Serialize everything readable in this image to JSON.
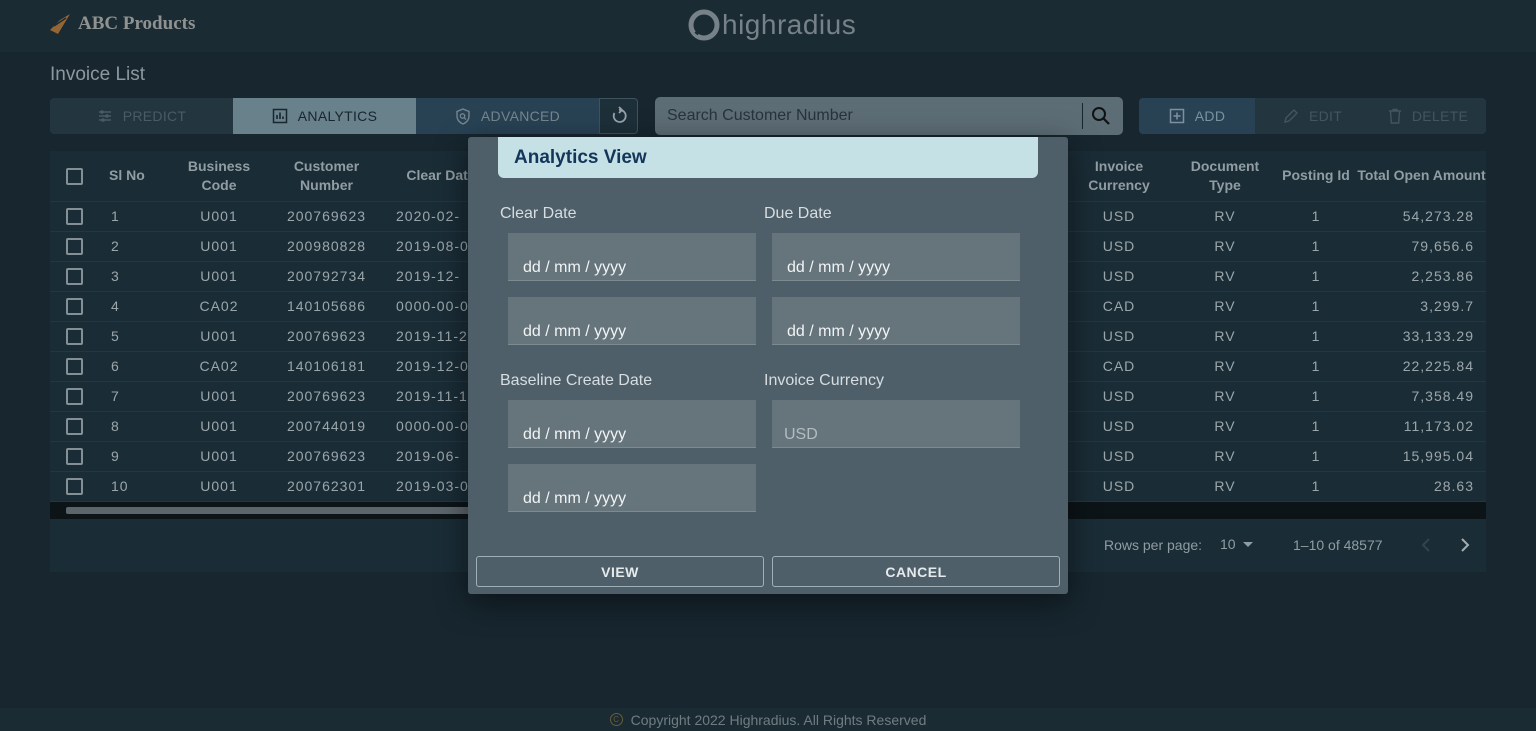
{
  "header": {
    "brand": "ABC Products",
    "center_logo": "highradius"
  },
  "page_title": "Invoice List",
  "toolbar": {
    "predict": "PREDICT",
    "analytics": "ANALYTICS",
    "advanced": "ADVANCED",
    "search_placeholder": "Search Customer Number",
    "add": "ADD",
    "edit": "EDIT",
    "delete": "DELETE"
  },
  "table": {
    "columns": [
      "Sl No",
      "Business Code",
      "Customer Number",
      "Clear Date",
      "Invoice Currency",
      "Document Type",
      "Posting Id",
      "Total Open Amount"
    ],
    "rows": [
      {
        "sl": "1",
        "bc": "U001",
        "cn": "200769623",
        "cd": "2020-02-",
        "cur": "USD",
        "dt": "RV",
        "pid": "1",
        "amt": "54,273.28"
      },
      {
        "sl": "2",
        "bc": "U001",
        "cn": "200980828",
        "cd": "2019-08-0",
        "cur": "USD",
        "dt": "RV",
        "pid": "1",
        "amt": "79,656.6"
      },
      {
        "sl": "3",
        "bc": "U001",
        "cn": "200792734",
        "cd": "2019-12-",
        "cur": "USD",
        "dt": "RV",
        "pid": "1",
        "amt": "2,253.86"
      },
      {
        "sl": "4",
        "bc": "CA02",
        "cn": "140105686",
        "cd": "0000-00-0",
        "cur": "CAD",
        "dt": "RV",
        "pid": "1",
        "amt": "3,299.7"
      },
      {
        "sl": "5",
        "bc": "U001",
        "cn": "200769623",
        "cd": "2019-11-2",
        "cur": "USD",
        "dt": "RV",
        "pid": "1",
        "amt": "33,133.29"
      },
      {
        "sl": "6",
        "bc": "CA02",
        "cn": "140106181",
        "cd": "2019-12-0",
        "cur": "CAD",
        "dt": "RV",
        "pid": "1",
        "amt": "22,225.84"
      },
      {
        "sl": "7",
        "bc": "U001",
        "cn": "200769623",
        "cd": "2019-11-1",
        "cur": "USD",
        "dt": "RV",
        "pid": "1",
        "amt": "7,358.49"
      },
      {
        "sl": "8",
        "bc": "U001",
        "cn": "200744019",
        "cd": "0000-00-0",
        "cur": "USD",
        "dt": "RV",
        "pid": "1",
        "amt": "11,173.02"
      },
      {
        "sl": "9",
        "bc": "U001",
        "cn": "200769623",
        "cd": "2019-06-",
        "cur": "USD",
        "dt": "RV",
        "pid": "1",
        "amt": "15,995.04"
      },
      {
        "sl": "10",
        "bc": "U001",
        "cn": "200762301",
        "cd": "2019-03-0",
        "cur": "USD",
        "dt": "RV",
        "pid": "1",
        "amt": "28.63"
      }
    ]
  },
  "pagination": {
    "rows_per_page_label": "Rows per page:",
    "rows_per_page": "10",
    "range": "1–10 of 48577"
  },
  "modal": {
    "title": "Analytics View",
    "clear_date_label": "Clear Date",
    "due_date_label": "Due Date",
    "baseline_label": "Baseline Create Date",
    "currency_label": "Invoice Currency",
    "date_placeholder": "dd / mm / yyyy",
    "currency_placeholder": "USD",
    "view": "VIEW",
    "cancel": "CANCEL"
  },
  "footer": {
    "copyright": "Copyright 2022 Highradius. All Rights Reserved"
  },
  "colors": {
    "background": "#1b2a33",
    "modal": "#4e5f69",
    "modal_header": "#c5e1e6",
    "accent": "#2e4a5f"
  }
}
